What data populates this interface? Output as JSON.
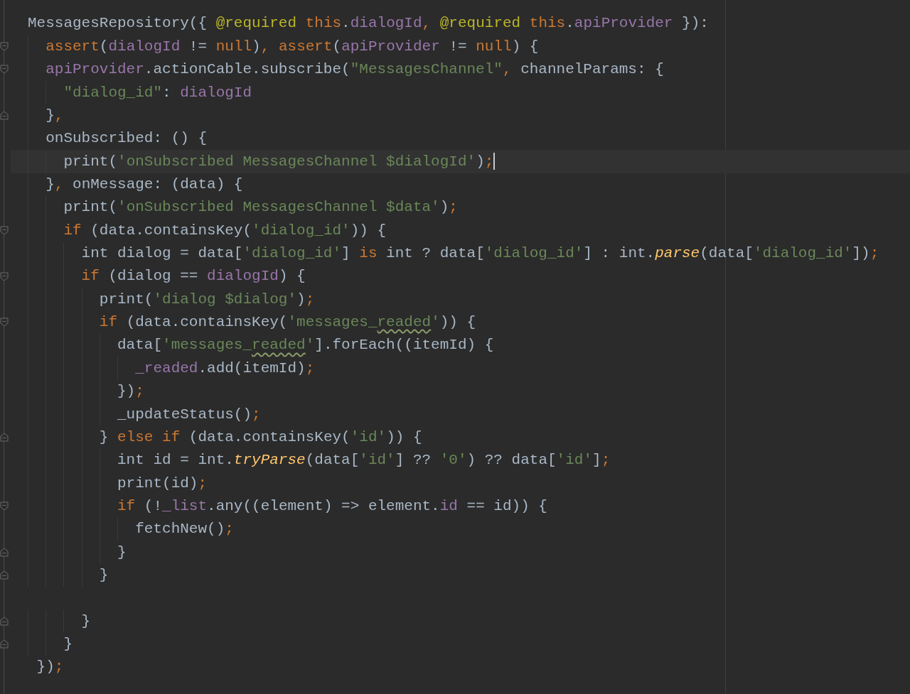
{
  "editor": {
    "lines": [
      {
        "kind": "plain",
        "current": false,
        "tokens": [
          {
            "kind": "plain",
            "text": "MessagesRepository({ "
          },
          {
            "kind": "annotation",
            "text": "@required "
          },
          {
            "kind": "keyword",
            "text": "this"
          },
          {
            "kind": "plain",
            "text": "."
          },
          {
            "kind": "field",
            "text": "dialogId"
          },
          {
            "kind": "keyword",
            "text": ", "
          },
          {
            "kind": "annotation",
            "text": "@required "
          },
          {
            "kind": "keyword",
            "text": "this"
          },
          {
            "kind": "plain",
            "text": "."
          },
          {
            "kind": "field",
            "text": "apiProvider"
          },
          {
            "kind": "plain",
            "text": " }):"
          }
        ]
      },
      {
        "kind": "fold-start",
        "current": false,
        "tokens": [
          {
            "kind": "keyword",
            "text": "  assert"
          },
          {
            "kind": "plain",
            "text": "("
          },
          {
            "kind": "field",
            "text": "dialogId"
          },
          {
            "kind": "plain",
            "text": " != "
          },
          {
            "kind": "keyword",
            "text": "null"
          },
          {
            "kind": "plain",
            "text": ")"
          },
          {
            "kind": "keyword",
            "text": ", assert"
          },
          {
            "kind": "plain",
            "text": "("
          },
          {
            "kind": "field",
            "text": "apiProvider"
          },
          {
            "kind": "plain",
            "text": " != "
          },
          {
            "kind": "keyword",
            "text": "null"
          },
          {
            "kind": "plain",
            "text": ") {"
          }
        ]
      },
      {
        "kind": "fold-start",
        "current": false,
        "tokens": [
          {
            "kind": "field",
            "text": "  apiProvider"
          },
          {
            "kind": "plain",
            "text": ".actionCable.subscribe("
          },
          {
            "kind": "string",
            "text": "\"MessagesChannel\""
          },
          {
            "kind": "keyword",
            "text": ","
          },
          {
            "kind": "plain",
            "text": " channelParams: {"
          }
        ]
      },
      {
        "kind": "plain",
        "current": false,
        "tokens": [
          {
            "kind": "string",
            "text": "    \"dialog_id\""
          },
          {
            "kind": "plain",
            "text": ": "
          },
          {
            "kind": "field",
            "text": "dialogId"
          }
        ]
      },
      {
        "kind": "fold-end",
        "current": false,
        "tokens": [
          {
            "kind": "plain",
            "text": "  }"
          },
          {
            "kind": "keyword",
            "text": ","
          }
        ]
      },
      {
        "kind": "plain",
        "current": false,
        "tokens": [
          {
            "kind": "plain",
            "text": "  onSubscribed: () {"
          }
        ]
      },
      {
        "kind": "plain",
        "current": true,
        "tokens": [
          {
            "kind": "plain",
            "text": "    print("
          },
          {
            "kind": "string",
            "text": "'onSubscribed MessagesChannel $dialogId'"
          },
          {
            "kind": "plain",
            "text": ")"
          },
          {
            "kind": "keyword",
            "text": ";"
          }
        ]
      },
      {
        "kind": "plain",
        "current": false,
        "tokens": [
          {
            "kind": "plain",
            "text": "  }"
          },
          {
            "kind": "keyword",
            "text": ","
          },
          {
            "kind": "plain",
            "text": " onMessage: (data) {"
          }
        ]
      },
      {
        "kind": "plain",
        "current": false,
        "tokens": [
          {
            "kind": "plain",
            "text": "    print("
          },
          {
            "kind": "string",
            "text": "'onSubscribed MessagesChannel $data'"
          },
          {
            "kind": "plain",
            "text": ")"
          },
          {
            "kind": "keyword",
            "text": ";"
          }
        ]
      },
      {
        "kind": "fold-start",
        "current": false,
        "tokens": [
          {
            "kind": "keyword",
            "text": "    if"
          },
          {
            "kind": "plain",
            "text": " (data.containsKey("
          },
          {
            "kind": "string",
            "text": "'dialog_id'"
          },
          {
            "kind": "plain",
            "text": ")) {"
          }
        ]
      },
      {
        "kind": "plain",
        "current": false,
        "tokens": [
          {
            "kind": "plain",
            "text": "      int dialog = data["
          },
          {
            "kind": "string",
            "text": "'dialog_id'"
          },
          {
            "kind": "plain",
            "text": "] "
          },
          {
            "kind": "keyword",
            "text": "is"
          },
          {
            "kind": "plain",
            "text": " int ? data["
          },
          {
            "kind": "string",
            "text": "'dialog_id'"
          },
          {
            "kind": "plain",
            "text": "] : int."
          },
          {
            "kind": "method",
            "text": "parse"
          },
          {
            "kind": "plain",
            "text": "(data["
          },
          {
            "kind": "string",
            "text": "'dialog_id'"
          },
          {
            "kind": "plain",
            "text": "])"
          },
          {
            "kind": "keyword",
            "text": ";"
          }
        ]
      },
      {
        "kind": "fold-start",
        "current": false,
        "tokens": [
          {
            "kind": "keyword",
            "text": "      if"
          },
          {
            "kind": "plain",
            "text": " (dialog == "
          },
          {
            "kind": "field",
            "text": "dialogId"
          },
          {
            "kind": "plain",
            "text": ") {"
          }
        ]
      },
      {
        "kind": "plain",
        "current": false,
        "tokens": [
          {
            "kind": "plain",
            "text": "        print("
          },
          {
            "kind": "string",
            "text": "'dialog $dialog'"
          },
          {
            "kind": "plain",
            "text": ")"
          },
          {
            "kind": "keyword",
            "text": ";"
          }
        ]
      },
      {
        "kind": "fold-start",
        "current": false,
        "tokens": [
          {
            "kind": "keyword",
            "text": "        if"
          },
          {
            "kind": "plain",
            "text": " (data.containsKey("
          },
          {
            "kind": "string",
            "text": "'messages_"
          },
          {
            "kind": "typo",
            "text": "readed"
          },
          {
            "kind": "string",
            "text": "'"
          },
          {
            "kind": "plain",
            "text": ")) {"
          }
        ]
      },
      {
        "kind": "plain",
        "current": false,
        "tokens": [
          {
            "kind": "plain",
            "text": "          data["
          },
          {
            "kind": "string",
            "text": "'messages_"
          },
          {
            "kind": "typo",
            "text": "readed"
          },
          {
            "kind": "string",
            "text": "'"
          },
          {
            "kind": "plain",
            "text": "].forEach((itemId) {"
          }
        ]
      },
      {
        "kind": "plain",
        "current": false,
        "tokens": [
          {
            "kind": "field",
            "text": "            _readed"
          },
          {
            "kind": "plain",
            "text": ".add(itemId)"
          },
          {
            "kind": "keyword",
            "text": ";"
          }
        ]
      },
      {
        "kind": "plain",
        "current": false,
        "tokens": [
          {
            "kind": "plain",
            "text": "          })"
          },
          {
            "kind": "keyword",
            "text": ";"
          }
        ]
      },
      {
        "kind": "plain",
        "current": false,
        "tokens": [
          {
            "kind": "plain",
            "text": "          _updateStatus()"
          },
          {
            "kind": "keyword",
            "text": ";"
          }
        ]
      },
      {
        "kind": "fold-end",
        "current": false,
        "tokens": [
          {
            "kind": "plain",
            "text": "        } "
          },
          {
            "kind": "keyword",
            "text": "else if"
          },
          {
            "kind": "plain",
            "text": " (data.containsKey("
          },
          {
            "kind": "string",
            "text": "'id'"
          },
          {
            "kind": "plain",
            "text": ")) {"
          }
        ]
      },
      {
        "kind": "plain",
        "current": false,
        "tokens": [
          {
            "kind": "plain",
            "text": "          int id = int."
          },
          {
            "kind": "method",
            "text": "tryParse"
          },
          {
            "kind": "plain",
            "text": "(data["
          },
          {
            "kind": "string",
            "text": "'id'"
          },
          {
            "kind": "plain",
            "text": "] ?? "
          },
          {
            "kind": "string",
            "text": "'0'"
          },
          {
            "kind": "plain",
            "text": ") ?? data["
          },
          {
            "kind": "string",
            "text": "'id'"
          },
          {
            "kind": "plain",
            "text": "]"
          },
          {
            "kind": "keyword",
            "text": ";"
          }
        ]
      },
      {
        "kind": "plain",
        "current": false,
        "tokens": [
          {
            "kind": "plain",
            "text": "          print(id)"
          },
          {
            "kind": "keyword",
            "text": ";"
          }
        ]
      },
      {
        "kind": "fold-start",
        "current": false,
        "tokens": [
          {
            "kind": "keyword",
            "text": "          if"
          },
          {
            "kind": "plain",
            "text": " (!"
          },
          {
            "kind": "field",
            "text": "_list"
          },
          {
            "kind": "plain",
            "text": ".any((element) => element."
          },
          {
            "kind": "field",
            "text": "id"
          },
          {
            "kind": "plain",
            "text": " == id)) {"
          }
        ]
      },
      {
        "kind": "plain",
        "current": false,
        "tokens": [
          {
            "kind": "plain",
            "text": "            fetchNew()"
          },
          {
            "kind": "keyword",
            "text": ";"
          }
        ]
      },
      {
        "kind": "fold-end",
        "current": false,
        "tokens": [
          {
            "kind": "plain",
            "text": "          }"
          }
        ]
      },
      {
        "kind": "fold-end",
        "current": false,
        "tokens": [
          {
            "kind": "plain",
            "text": "        }"
          }
        ]
      },
      {
        "kind": "plain",
        "current": false
      },
      {
        "kind": "fold-end",
        "current": false,
        "tokens": [
          {
            "kind": "plain",
            "text": "      }"
          }
        ]
      },
      {
        "kind": "fold-end",
        "current": false,
        "tokens": [
          {
            "kind": "plain",
            "text": "    }"
          }
        ]
      },
      {
        "kind": "plain",
        "current": false,
        "tokens": [
          {
            "kind": "plain",
            "text": " })"
          },
          {
            "kind": "keyword",
            "text": ";"
          }
        ]
      }
    ]
  }
}
